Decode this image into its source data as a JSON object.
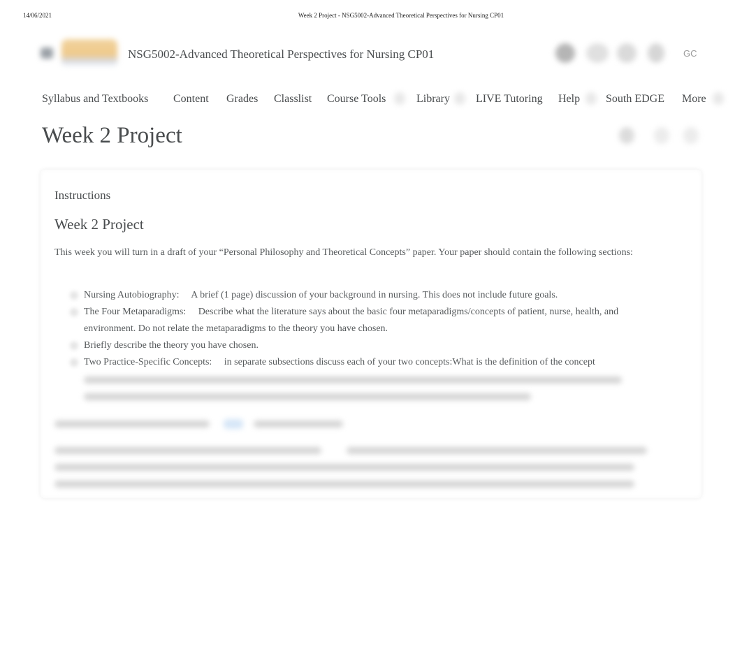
{
  "print_header": {
    "date": "14/06/2021",
    "title": "Week 2 Project - NSG5002-Advanced Theoretical Perspectives for Nursing CP01"
  },
  "navbar": {
    "course_title": "NSG5002-Advanced Theoretical Perspectives for Nursing CP01",
    "user_initials": "GC",
    "icons": [
      "menu-icon",
      "message-icon",
      "email-icon",
      "bell-icon",
      "user-icon"
    ]
  },
  "nav": {
    "items": [
      {
        "label": "Syllabus and Textbooks"
      },
      {
        "label": "Content"
      },
      {
        "label": "Grades"
      },
      {
        "label": "Classlist"
      },
      {
        "label": "Course Tools"
      },
      {
        "label": "Library"
      },
      {
        "label": "LIVE Tutoring"
      },
      {
        "label": "Help"
      },
      {
        "label": "South EDGE"
      },
      {
        "label": "More"
      }
    ]
  },
  "page": {
    "title": "Week 2 Project"
  },
  "content": {
    "instructions_label": "Instructions",
    "section_title": "Week 2 Project",
    "intro": "This week you will turn in a draft of your “Personal Philosophy and Theoretical Concepts” paper. Your paper should contain the following sections:",
    "requirements": [
      {
        "label": "Nursing Autobiography:",
        "text": "A brief (1 page) discussion of your background in nursing. This does not include future goals."
      },
      {
        "label": "The Four Metaparadigms:",
        "text": "Describe what the literature says about the basic four metaparadigms/concepts of patient, nurse, health, and environment. Do not relate the metaparadigms to the theory you have chosen."
      },
      {
        "label": "",
        "text": "Briefly describe the theory you have chosen."
      },
      {
        "label": "Two Practice-Specific Concepts:",
        "text": "in separate subsections discuss each of your two concepts:What is the definition of the concept"
      }
    ]
  }
}
